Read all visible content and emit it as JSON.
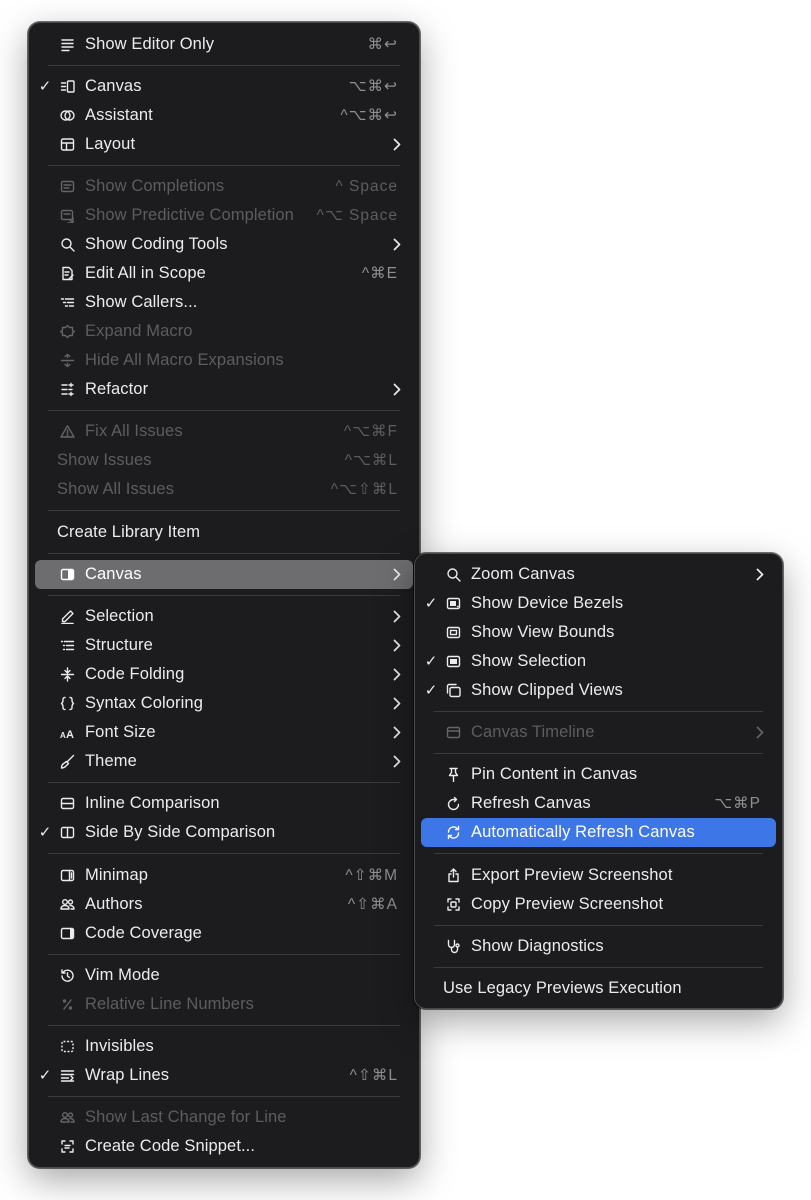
{
  "colors": {
    "menu_bg": "#1c1c1e",
    "hover_bg": "#6d6d70",
    "accent": "#3d76e6",
    "text": "#ececec",
    "text_disabled": "#5d5d61",
    "shortcut": "#8e8e93"
  },
  "main_menu": {
    "items": [
      {
        "label": "Show Editor Only",
        "icon": "editor-lines-icon",
        "shortcut": "⌘↩",
        "checked": false,
        "enabled": true,
        "submenu": false
      },
      {
        "label": "Canvas",
        "icon": "canvas-layout-icon",
        "shortcut": "⌥⌘↩",
        "checked": true,
        "enabled": true,
        "submenu": false
      },
      {
        "label": "Assistant",
        "icon": "assistant-circles-icon",
        "shortcut": "^⌥⌘↩",
        "checked": false,
        "enabled": true,
        "submenu": false
      },
      {
        "label": "Layout",
        "icon": "layout-icon",
        "shortcut": "",
        "checked": false,
        "enabled": true,
        "submenu": true
      },
      {
        "label": "Show Completions",
        "icon": "completions-icon",
        "shortcut": "^ Space",
        "checked": false,
        "enabled": false,
        "submenu": false
      },
      {
        "label": "Show Predictive Completion",
        "icon": "predictive-completion-icon",
        "shortcut": "^⌥ Space",
        "checked": false,
        "enabled": false,
        "submenu": false
      },
      {
        "label": "Show Coding Tools",
        "icon": "magnifier-icon",
        "shortcut": "",
        "checked": false,
        "enabled": true,
        "submenu": true
      },
      {
        "label": "Edit All in Scope",
        "icon": "edit-scope-icon",
        "shortcut": "^⌘E",
        "checked": false,
        "enabled": true,
        "submenu": false
      },
      {
        "label": "Show Callers...",
        "icon": "callers-list-icon",
        "shortcut": "",
        "checked": false,
        "enabled": true,
        "submenu": false
      },
      {
        "label": "Expand Macro",
        "icon": "expand-macro-icon",
        "shortcut": "",
        "checked": false,
        "enabled": false,
        "submenu": false
      },
      {
        "label": "Hide All Macro Expansions",
        "icon": "hide-macro-icon",
        "shortcut": "",
        "checked": false,
        "enabled": false,
        "submenu": false
      },
      {
        "label": "Refactor",
        "icon": "refactor-icon",
        "shortcut": "",
        "checked": false,
        "enabled": true,
        "submenu": true
      },
      {
        "label": "Fix All Issues",
        "icon": "warning-triangle-icon",
        "shortcut": "^⌥⌘F",
        "checked": false,
        "enabled": false,
        "submenu": false
      },
      {
        "label": "Show Issues",
        "icon": "",
        "shortcut": "^⌥⌘L",
        "checked": false,
        "enabled": false,
        "submenu": false
      },
      {
        "label": "Show All Issues",
        "icon": "",
        "shortcut": "^⌥⇧⌘L",
        "checked": false,
        "enabled": false,
        "submenu": false
      },
      {
        "label": "Create Library Item",
        "icon": "",
        "shortcut": "",
        "checked": false,
        "enabled": true,
        "submenu": false
      },
      {
        "label": "Canvas",
        "icon": "canvas-panel-icon",
        "shortcut": "",
        "checked": false,
        "enabled": true,
        "submenu": true
      },
      {
        "label": "Selection",
        "icon": "pencil-icon",
        "shortcut": "",
        "checked": false,
        "enabled": true,
        "submenu": true
      },
      {
        "label": "Structure",
        "icon": "structure-icon",
        "shortcut": "",
        "checked": false,
        "enabled": true,
        "submenu": true
      },
      {
        "label": "Code Folding",
        "icon": "code-folding-icon",
        "shortcut": "",
        "checked": false,
        "enabled": true,
        "submenu": true
      },
      {
        "label": "Syntax Coloring",
        "icon": "braces-icon",
        "shortcut": "",
        "checked": false,
        "enabled": true,
        "submenu": true
      },
      {
        "label": "Font Size",
        "icon": "font-size-icon",
        "shortcut": "",
        "checked": false,
        "enabled": true,
        "submenu": true
      },
      {
        "label": "Theme",
        "icon": "paintbrush-icon",
        "shortcut": "",
        "checked": false,
        "enabled": true,
        "submenu": true
      },
      {
        "label": "Inline Comparison",
        "icon": "inline-comparison-icon",
        "shortcut": "",
        "checked": false,
        "enabled": true,
        "submenu": false
      },
      {
        "label": "Side By Side Comparison",
        "icon": "side-by-side-icon",
        "shortcut": "",
        "checked": true,
        "enabled": true,
        "submenu": false
      },
      {
        "label": "Minimap",
        "icon": "minimap-icon",
        "shortcut": "^⇧⌘M",
        "checked": false,
        "enabled": true,
        "submenu": false
      },
      {
        "label": "Authors",
        "icon": "authors-icon",
        "shortcut": "^⇧⌘A",
        "checked": false,
        "enabled": true,
        "submenu": false
      },
      {
        "label": "Code Coverage",
        "icon": "code-coverage-icon",
        "shortcut": "",
        "checked": false,
        "enabled": true,
        "submenu": false
      },
      {
        "label": "Vim Mode",
        "icon": "vim-mode-icon",
        "shortcut": "",
        "checked": false,
        "enabled": true,
        "submenu": false
      },
      {
        "label": "Relative Line Numbers",
        "icon": "relative-lines-icon",
        "shortcut": "",
        "checked": false,
        "enabled": false,
        "submenu": false
      },
      {
        "label": "Invisibles",
        "icon": "invisibles-icon",
        "shortcut": "",
        "checked": false,
        "enabled": true,
        "submenu": false
      },
      {
        "label": "Wrap Lines",
        "icon": "wrap-lines-icon",
        "shortcut": "^⇧⌘L",
        "checked": true,
        "enabled": true,
        "submenu": false
      },
      {
        "label": "Show Last Change for Line",
        "icon": "last-change-icon",
        "shortcut": "",
        "checked": false,
        "enabled": false,
        "submenu": false
      },
      {
        "label": "Create Code Snippet...",
        "icon": "code-snippet-icon",
        "shortcut": "",
        "checked": false,
        "enabled": true,
        "submenu": false
      }
    ]
  },
  "canvas_submenu": {
    "items": [
      {
        "label": "Zoom Canvas",
        "icon": "zoom-icon",
        "shortcut": "",
        "checked": false,
        "enabled": true,
        "submenu": true
      },
      {
        "label": "Show Device Bezels",
        "icon": "device-bezels-icon",
        "shortcut": "",
        "checked": true,
        "enabled": true,
        "submenu": false
      },
      {
        "label": "Show View Bounds",
        "icon": "view-bounds-icon",
        "shortcut": "",
        "checked": false,
        "enabled": true,
        "submenu": false
      },
      {
        "label": "Show Selection",
        "icon": "selection-rect-icon",
        "shortcut": "",
        "checked": true,
        "enabled": true,
        "submenu": false
      },
      {
        "label": "Show Clipped Views",
        "icon": "clipped-views-icon",
        "shortcut": "",
        "checked": true,
        "enabled": true,
        "submenu": false
      },
      {
        "label": "Canvas Timeline",
        "icon": "timeline-icon",
        "shortcut": "",
        "checked": false,
        "enabled": false,
        "submenu": true
      },
      {
        "label": "Pin Content in Canvas",
        "icon": "pin-icon",
        "shortcut": "",
        "checked": false,
        "enabled": true,
        "submenu": false
      },
      {
        "label": "Refresh Canvas",
        "icon": "refresh-icon",
        "shortcut": "⌥⌘P",
        "checked": false,
        "enabled": true,
        "submenu": false
      },
      {
        "label": "Automatically Refresh Canvas",
        "icon": "auto-refresh-icon",
        "shortcut": "",
        "checked": false,
        "enabled": true,
        "submenu": false
      },
      {
        "label": "Export Preview Screenshot",
        "icon": "export-icon",
        "shortcut": "",
        "checked": false,
        "enabled": true,
        "submenu": false
      },
      {
        "label": "Copy Preview Screenshot",
        "icon": "copy-screenshot-icon",
        "shortcut": "",
        "checked": false,
        "enabled": true,
        "submenu": false
      },
      {
        "label": "Show Diagnostics",
        "icon": "stethoscope-icon",
        "shortcut": "",
        "checked": false,
        "enabled": true,
        "submenu": false
      },
      {
        "label": "Use Legacy Previews Execution",
        "icon": "",
        "shortcut": "",
        "checked": false,
        "enabled": true,
        "submenu": false
      }
    ]
  }
}
